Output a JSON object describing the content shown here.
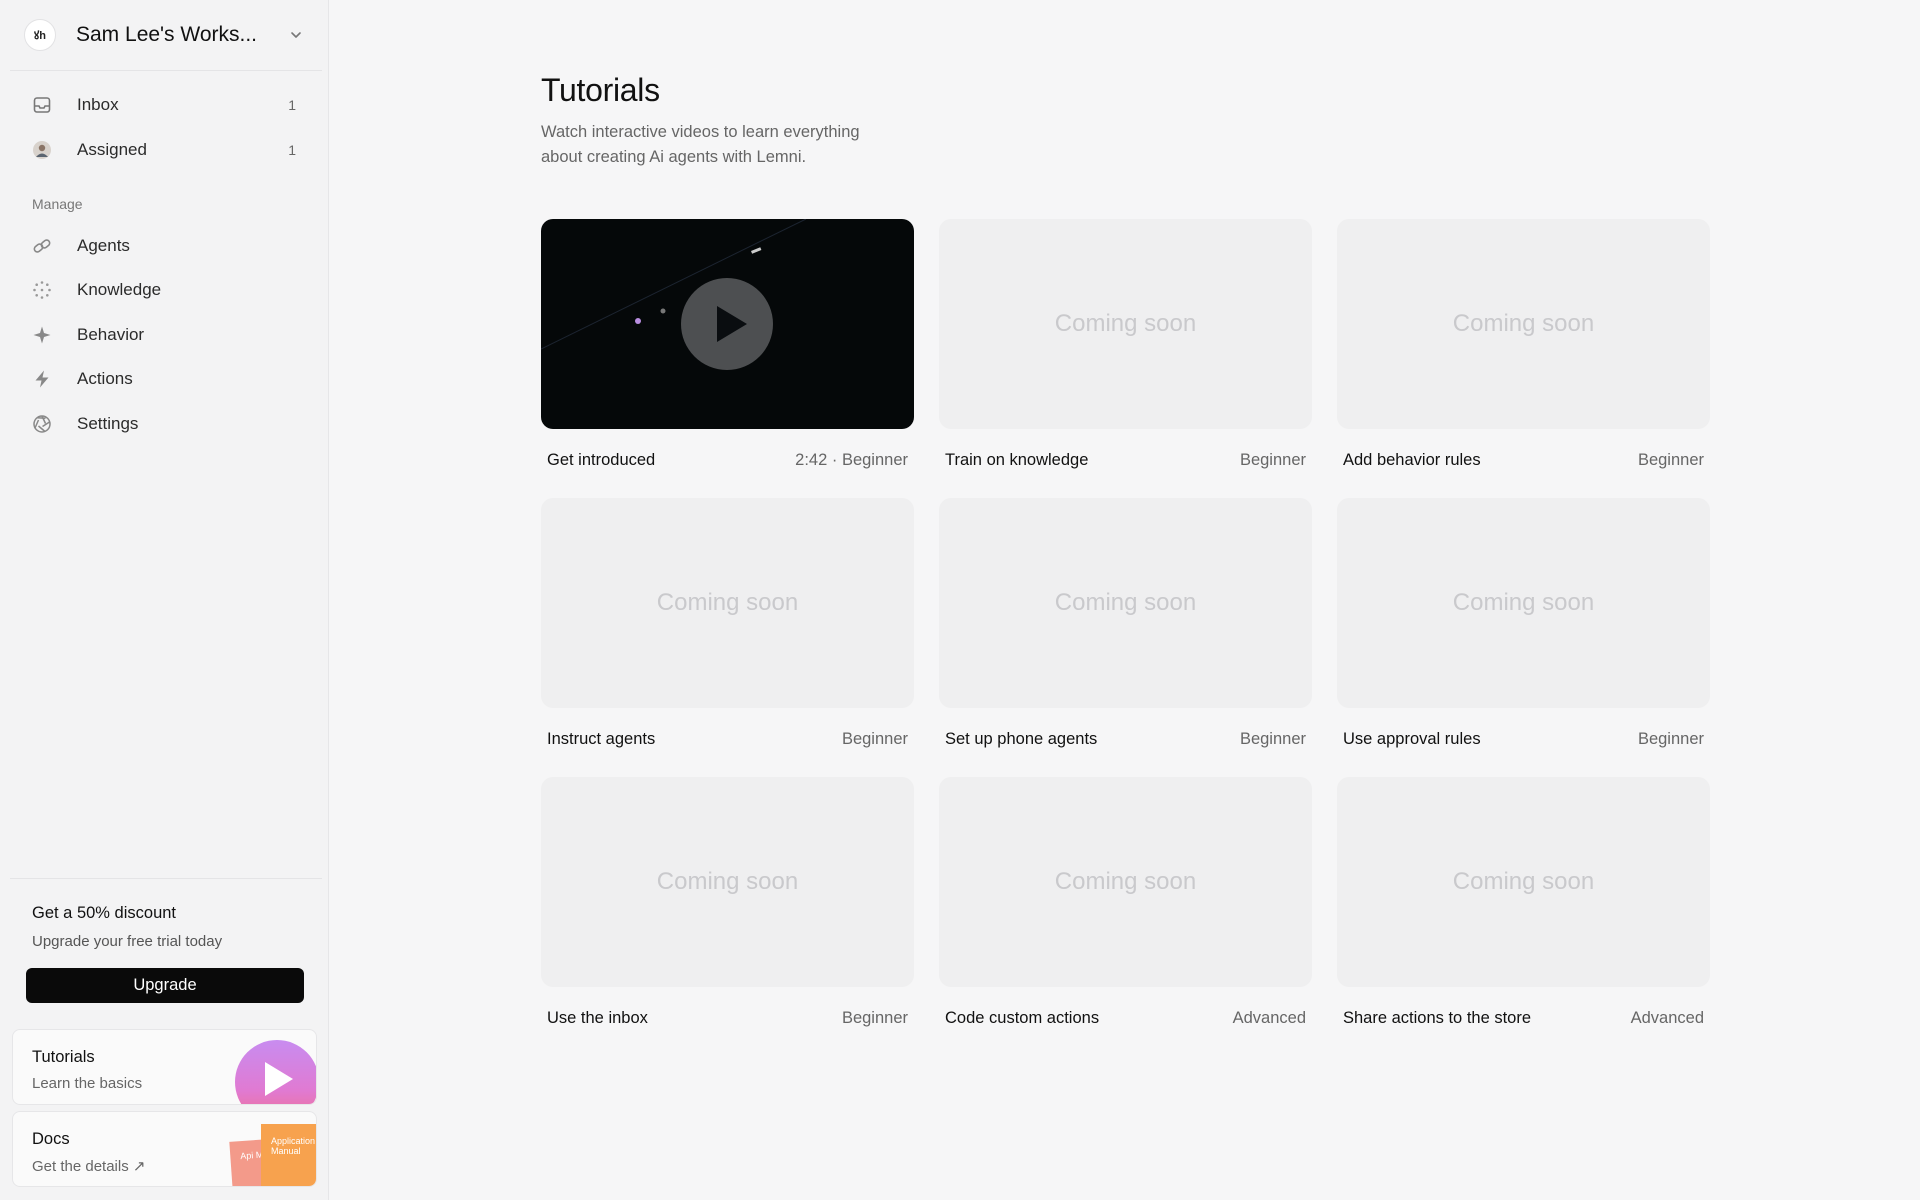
{
  "workspace": {
    "logo_text": "ꙋh",
    "name": "Sam Lee's Works..."
  },
  "inbox": [
    {
      "label": "Inbox",
      "count": "1",
      "icon": "inbox-icon"
    },
    {
      "label": "Assigned",
      "count": "1",
      "icon": "avatar"
    }
  ],
  "manage": {
    "label": "Manage",
    "items": [
      {
        "label": "Agents",
        "icon": "link-icon"
      },
      {
        "label": "Knowledge",
        "icon": "dots-circle-icon"
      },
      {
        "label": "Behavior",
        "icon": "sparkle-icon"
      },
      {
        "label": "Actions",
        "icon": "lightning-icon"
      },
      {
        "label": "Settings",
        "icon": "aperture-icon"
      }
    ]
  },
  "promo": {
    "title": "Get a 50% discount",
    "subtitle": "Upgrade your free trial today",
    "button": "Upgrade"
  },
  "help_cards": {
    "tutorials": {
      "title": "Tutorials",
      "subtitle": "Learn the basics"
    },
    "docs": {
      "title": "Docs",
      "subtitle": "Get the details ↗",
      "art_text_1": "Api Man",
      "art_text_2": "Application Manual"
    }
  },
  "page": {
    "title": "Tutorials",
    "subtitle": "Watch interactive videos to learn everything about creating Ai agents with Lemni."
  },
  "tiles": [
    {
      "title": "Get introduced",
      "tag": "2:42 · Beginner",
      "thumb": "video"
    },
    {
      "title": "Train on knowledge",
      "tag": "Beginner",
      "thumb": "Coming soon"
    },
    {
      "title": "Add behavior rules",
      "tag": "Beginner",
      "thumb": "Coming soon"
    },
    {
      "title": "Instruct agents",
      "tag": "Beginner",
      "thumb": "Coming soon"
    },
    {
      "title": "Set up phone agents",
      "tag": "Beginner",
      "thumb": "Coming soon"
    },
    {
      "title": "Use approval rules",
      "tag": "Beginner",
      "thumb": "Coming soon"
    },
    {
      "title": "Use the inbox",
      "tag": "Beginner",
      "thumb": "Coming soon"
    },
    {
      "title": "Code custom actions",
      "tag": "Advanced",
      "thumb": "Coming soon"
    },
    {
      "title": "Share actions to the store",
      "tag": "Advanced",
      "thumb": "Coming soon"
    }
  ]
}
